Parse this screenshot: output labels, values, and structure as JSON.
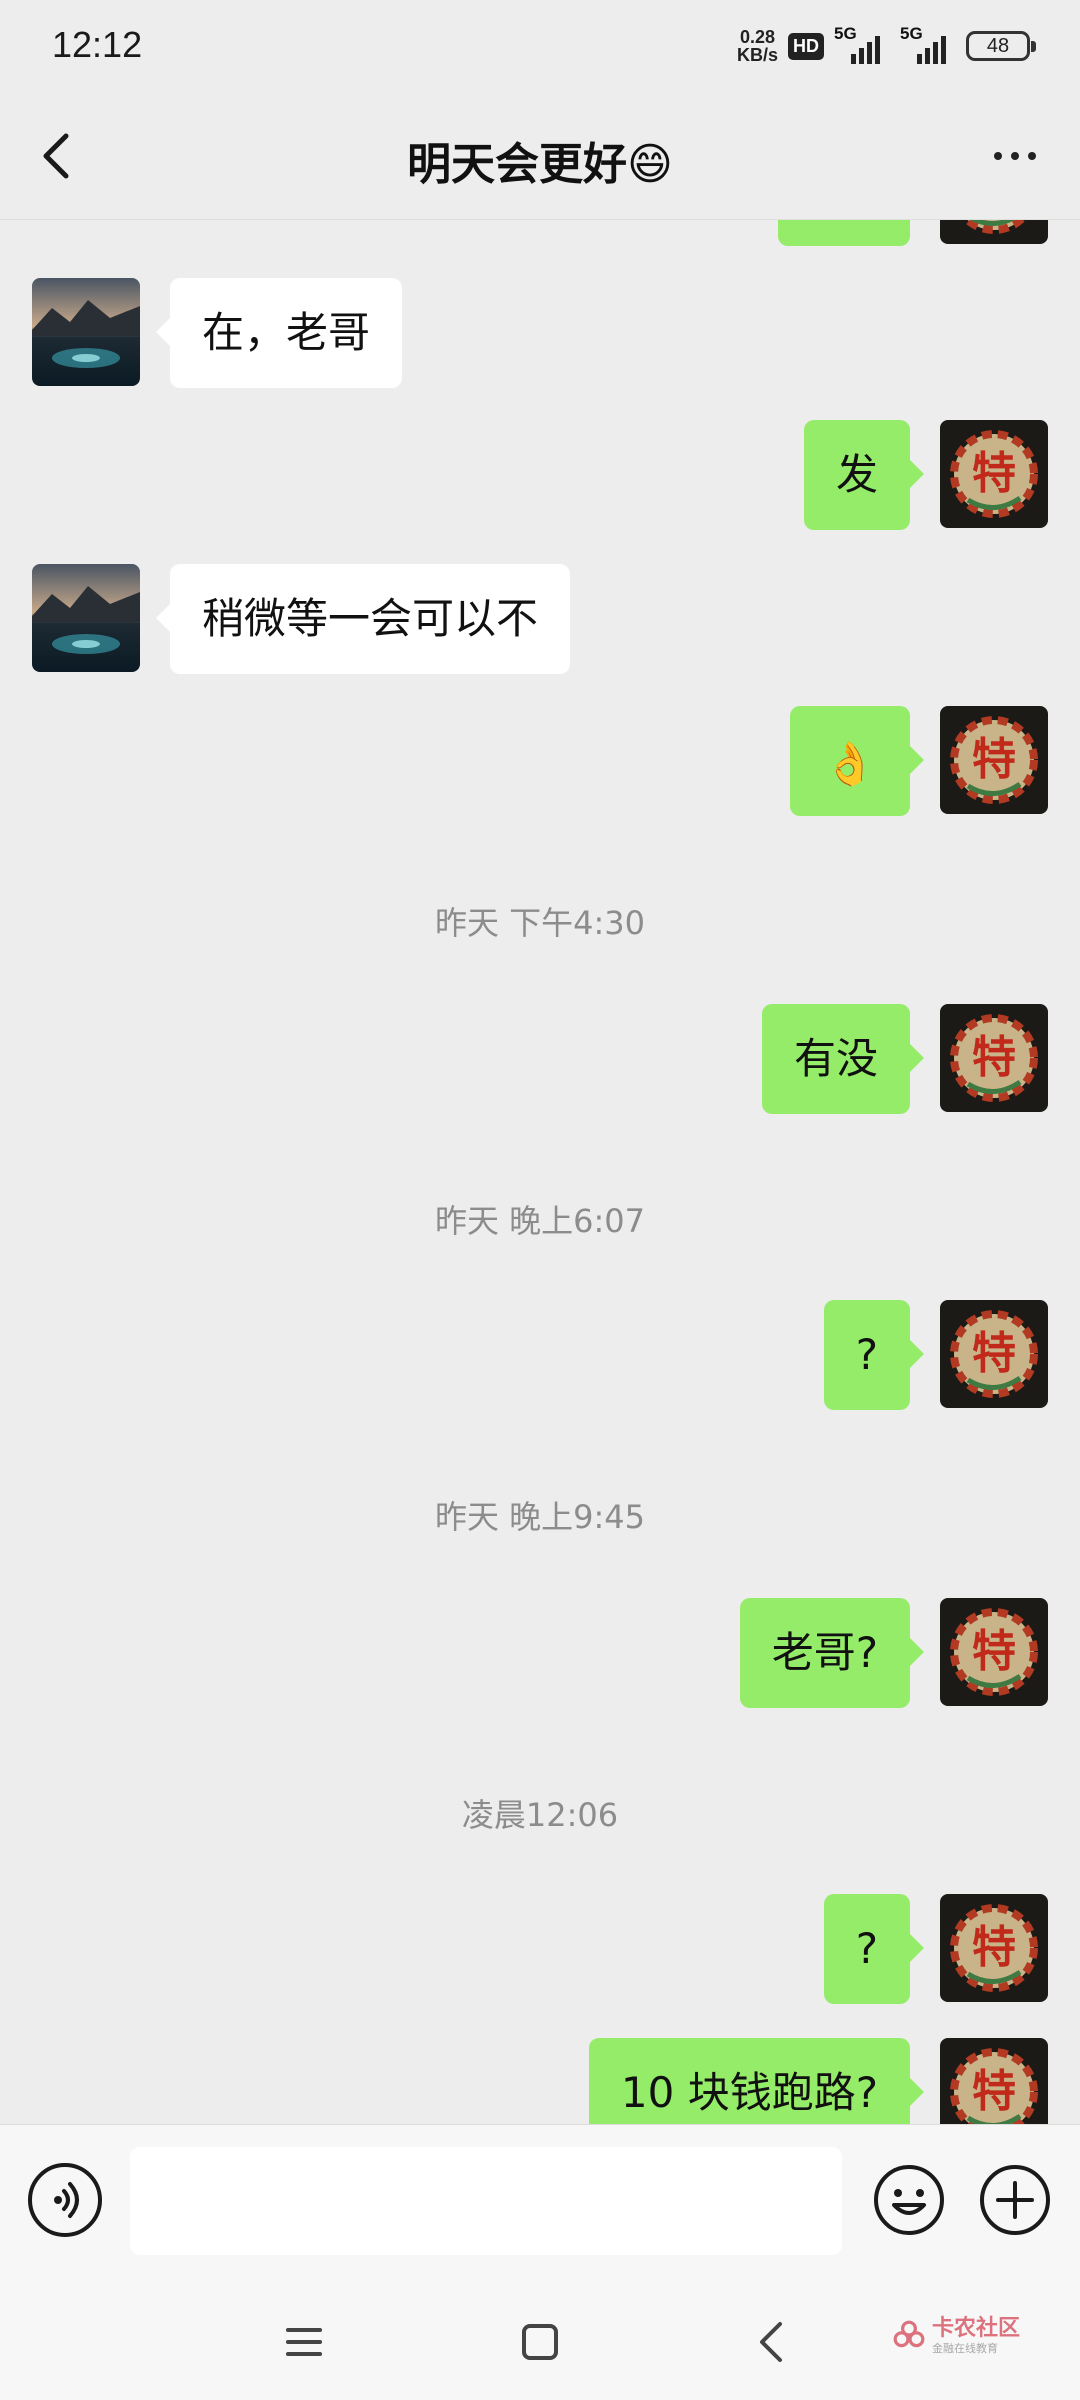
{
  "status_bar": {
    "time": "12:12",
    "net_speed_value": "0.28",
    "net_speed_unit": "KB/s",
    "hd_badge": "HD",
    "signal1_label": "5G",
    "signal2_label": "5G",
    "battery": "48"
  },
  "header": {
    "title": "明天会更好😄",
    "back_icon": "chevron-left-icon",
    "more_icon": "more-dots-icon"
  },
  "messages": [
    {
      "type": "text",
      "side": "out",
      "text": ""
    },
    {
      "type": "text",
      "side": "in",
      "text": "在，老哥"
    },
    {
      "type": "text",
      "side": "out",
      "text": "发"
    },
    {
      "type": "text",
      "side": "in",
      "text": "稍微等一会可以不"
    },
    {
      "type": "emoji",
      "side": "out",
      "text": "👌"
    },
    {
      "type": "time",
      "text": "昨天 下午4:30"
    },
    {
      "type": "text",
      "side": "out",
      "text": "有没"
    },
    {
      "type": "time",
      "text": "昨天 晚上6:07"
    },
    {
      "type": "text",
      "side": "out",
      "text": "?"
    },
    {
      "type": "time",
      "text": "昨天 晚上9:45"
    },
    {
      "type": "text",
      "side": "out",
      "text": "老哥?"
    },
    {
      "type": "time",
      "text": "凌晨12:06"
    },
    {
      "type": "text",
      "side": "out",
      "text": "?"
    },
    {
      "type": "text",
      "side": "out",
      "text": "10 块钱跑路?"
    }
  ],
  "avatars": {
    "contact_avatar_text": "",
    "self_avatar_char": "特"
  },
  "input_bar": {
    "placeholder": "",
    "voice_icon": "voice-icon",
    "emoji_icon": "smiley-icon",
    "plus_icon": "plus-icon"
  },
  "nav_bar": {
    "menu_icon": "menu-icon",
    "home_icon": "home-square-icon",
    "back_icon": "back-triangle-icon",
    "watermark_main": "卡农社区",
    "watermark_sub": "金融在线教育"
  },
  "colors": {
    "outgoing_bubble": "#95ec69",
    "incoming_bubble": "#ffffff",
    "background": "#ededed"
  }
}
